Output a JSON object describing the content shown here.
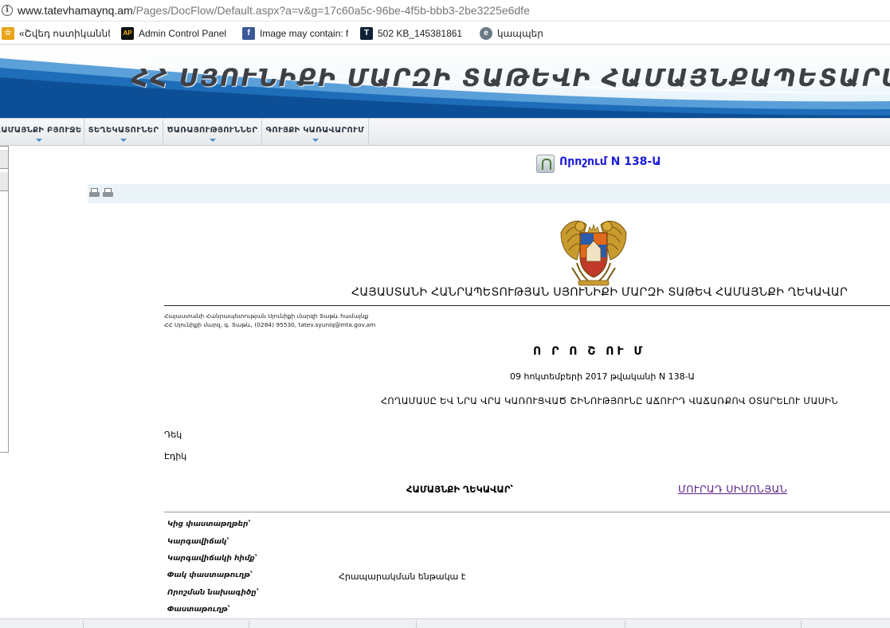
{
  "browser": {
    "url_host": "www.tatevhamaynq.am",
    "url_path": "/Pages/DocFlow/Default.aspx?a=v&g=17c60a5c-96be-4f5b-bbb3-2be3225e6dfe",
    "bookmarks": [
      {
        "label": "«Շվեդ ոստիկաննե",
        "icon": "bookmark-star-icon"
      },
      {
        "label": "Admin Control Panel",
        "icon": "ap-logo-icon"
      },
      {
        "label": "Image may contain: f",
        "icon": "facebook-icon"
      },
      {
        "label": "502 KB_145381861",
        "icon": "t-logo-icon"
      },
      {
        "label": "կապպեր",
        "icon": "e-logo-icon"
      }
    ]
  },
  "site": {
    "banner_title": "ՀՀ ՍՅՈՒՆԻՔԻ ՄԱՐԶԻ ՏԱԹԵՎԻ ՀԱՄԱՅՆՔԱՊԵՏԱՐԱՆ",
    "nav": [
      {
        "label": "ՀԱՄԱՅՆՔԻ ԲՅՈՒՋԵ"
      },
      {
        "label": "ՏԵՂԵԿԱՏՈՒՆԵՐ"
      },
      {
        "label": "ԾԱՌԱՅՈՒԹՅՈՒՆՆԵՐ"
      },
      {
        "label": "ԳՈՒՅՔԻ ԿԱՌԱՎԱՐՈՒՄ"
      }
    ]
  },
  "document": {
    "title": "Որոշում N 138-Ա",
    "heading": "ՀԱՅԱՍՏԱՆԻ ՀԱՆՐԱՊԵՏՈՒԹՅԱՆ ՍՅՈՒՆԻՔԻ ՄԱՐԶԻ ՏԱԹԵՎ ՀԱՄԱՅՆՔԻ ՂԵԿԱՎԱՐ",
    "address_line1": "Հայաստանի Հանրապետության Սյունիքի մարզի Տաթև համայնք",
    "address_line2": "ՀՀ Սյունիքի մարզ, գ. Տաթև, (0284) 95530, tatev.syuniq@mta.gov.am",
    "order_title": "Ո Ր Ո Շ ՈՒ Մ",
    "order_date": "09 հոկտեմբերի 2017 թվականի N 138-Ա",
    "subject": "ՀՈՂԱՄԱՍԸ ԵՎ ՆՐԱ ՎՐԱ ԿԱՌՈՒՑՎԱԾ ՇԻՆՈՒԹՅՈՒՆԸ ԱՃՈՒՐԴ ՎԱՃԱՌՔՈՎ ՕՏԱՐԵԼՈՒ ՄԱՍԻՆ",
    "addressee_title": "Դեկ",
    "addressee_name": "Էդիկ",
    "signer_role": "ՀԱՄԱՅՆՔԻ ՂԵԿԱՎԱՐ՝",
    "signer_name": "ՄՈՒՐԱԴ ՍԻՄՈՆՅԱՆ",
    "meta_labels": [
      "Կից փաստաթղթեր՝",
      "Կարգավիճակ՝",
      "Կարգավիճակի հիմք՝",
      "Փակ փաստաթուղթ՝",
      "Որոշման նախագիծը՝",
      "Փաստաթուղթ՝"
    ],
    "closed_doc_value": "Հրապարակման ենթակա է"
  },
  "colors": {
    "doc_title": "#1b1bd6",
    "signer_link": "#5b1f86",
    "toolbar_bg": "#eaf3f8"
  }
}
